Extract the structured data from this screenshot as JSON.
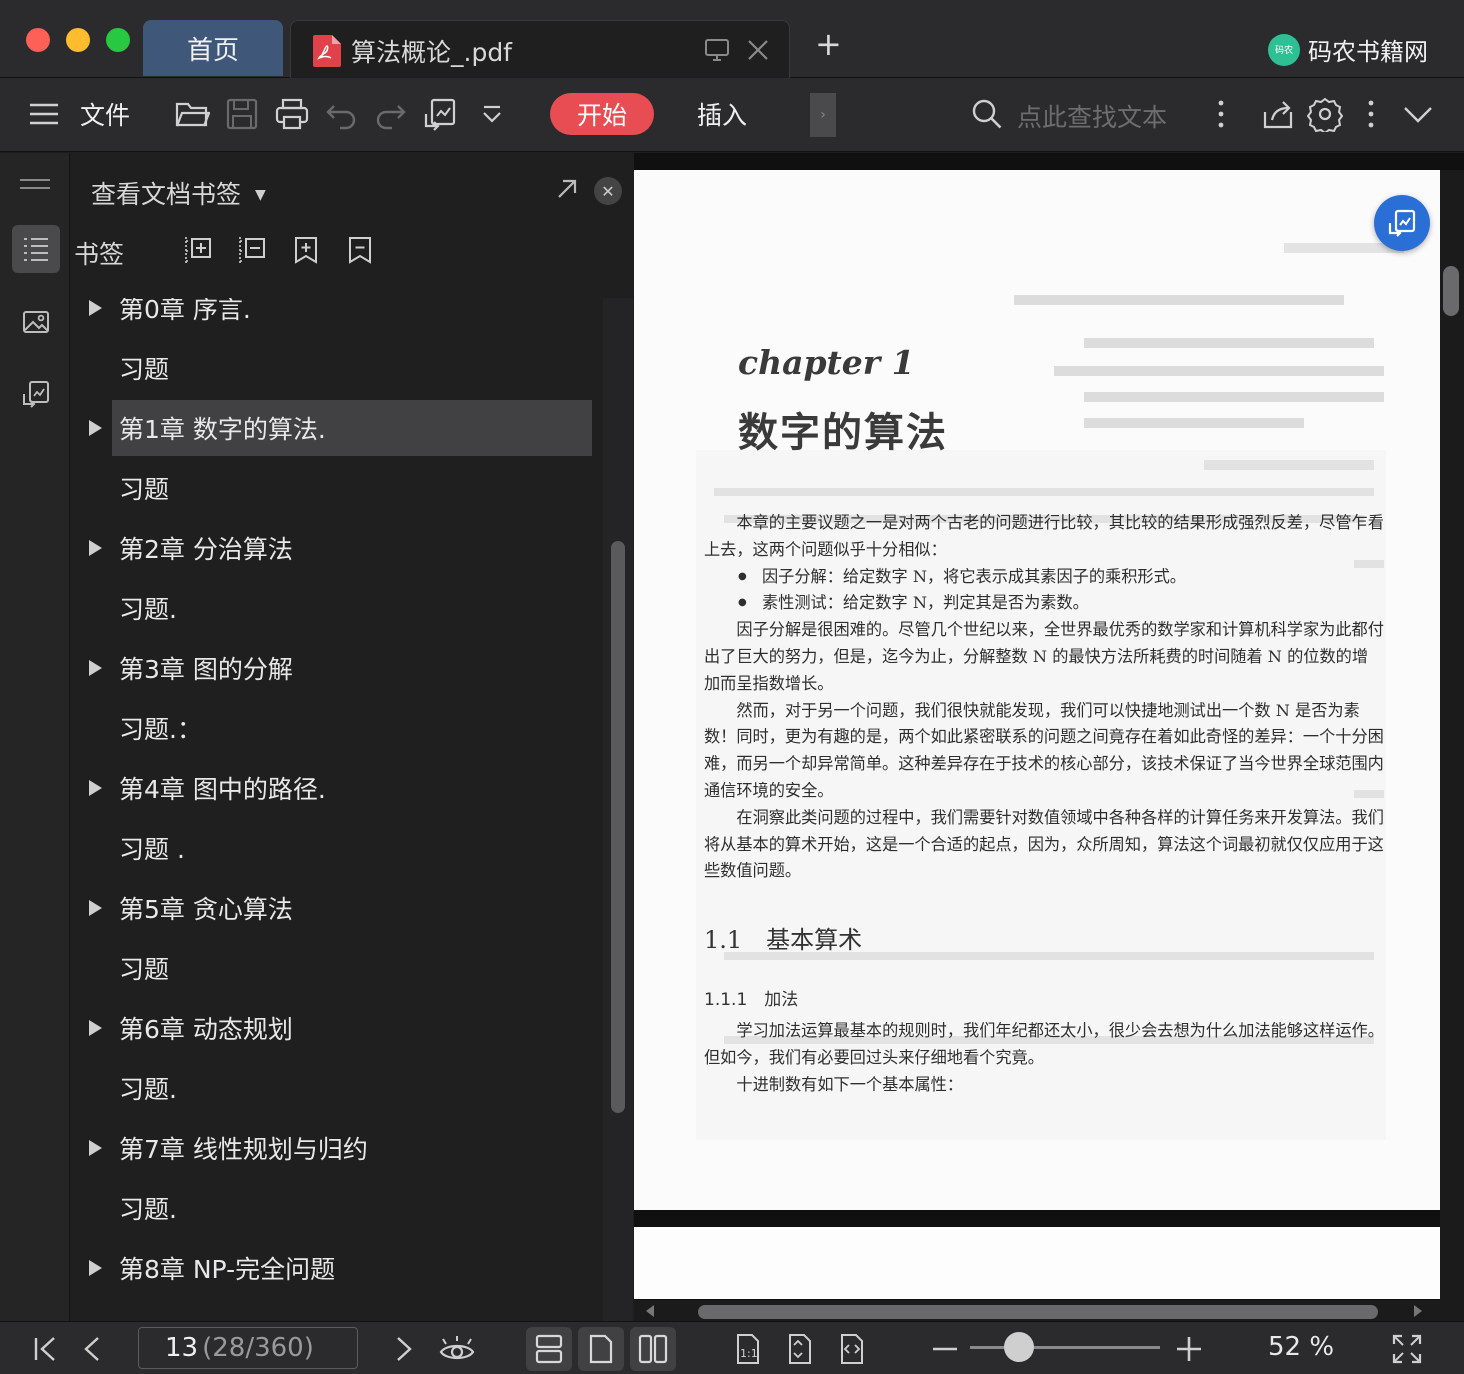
{
  "titlebar": {
    "tabs": [
      {
        "label": "首页"
      },
      {
        "label": "算法概论_.pdf"
      }
    ],
    "new_tab_symbol": "+",
    "brand": {
      "logo_text": "码农",
      "name": "码农书籍网",
      "logo_color": "#2fbf94"
    },
    "traffic_lights": {
      "close": "#fe5f57",
      "minimize": "#febc2e",
      "maximize": "#28c840"
    }
  },
  "toolbar": {
    "file_label": "文件",
    "start_label": "开始",
    "insert_label": "插入",
    "more_symbol": "›",
    "search_placeholder": "点此查找文本",
    "accent_color": "#e94d54"
  },
  "panel": {
    "title": "查看文档书签",
    "bookmarks_label": "书签",
    "close_symbol": "✕",
    "items": [
      {
        "text": "第0章 序言.",
        "has_children": true,
        "selected": false
      },
      {
        "text": "习题",
        "has_children": false,
        "selected": false
      },
      {
        "text": "第1章 数字的算法.",
        "has_children": true,
        "selected": true
      },
      {
        "text": "习题",
        "has_children": false,
        "selected": false
      },
      {
        "text": "第2章 分治算法",
        "has_children": true,
        "selected": false
      },
      {
        "text": "习题.",
        "has_children": false,
        "selected": false
      },
      {
        "text": "第3章 图的分解",
        "has_children": true,
        "selected": false
      },
      {
        "text": "习题.：",
        "has_children": false,
        "selected": false
      },
      {
        "text": "第4章 图中的路径.",
        "has_children": true,
        "selected": false
      },
      {
        "text": "习题 .",
        "has_children": false,
        "selected": false
      },
      {
        "text": "第5章 贪心算法",
        "has_children": true,
        "selected": false
      },
      {
        "text": "习题",
        "has_children": false,
        "selected": false
      },
      {
        "text": "第6章 动态规划",
        "has_children": true,
        "selected": false
      },
      {
        "text": "习题.",
        "has_children": false,
        "selected": false
      },
      {
        "text": "第7章 线性规划与归约",
        "has_children": true,
        "selected": false
      },
      {
        "text": "习题.",
        "has_children": false,
        "selected": false
      },
      {
        "text": "第8章 NP-完全问题",
        "has_children": true,
        "selected": false
      }
    ]
  },
  "document": {
    "chapter_label": "chapter 1",
    "chapter_title": "数字的算法",
    "paragraphs": [
      {
        "kind": "p",
        "text": "本章的主要议题之一是对两个古老的问题进行比较，其比较的结果形成强烈反差，尽管乍看上去，这两个问题似乎十分相似："
      },
      {
        "kind": "bullet",
        "text": "因子分解：给定数字 N，将它表示成其素因子的乘积形式。"
      },
      {
        "kind": "bullet",
        "text": "素性测试：给定数字 N，判定其是否为素数。"
      },
      {
        "kind": "p",
        "text": "因子分解是很困难的。尽管几个世纪以来，全世界最优秀的数学家和计算机科学家为此都付出了巨大的努力，但是，迄今为止，分解整数 N 的最快方法所耗费的时间随着 N 的位数的增加而呈指数增长。"
      },
      {
        "kind": "p",
        "text": "然而，对于另一个问题，我们很快就能发现，我们可以快捷地测试出一个数 N 是否为素数！同时，更为有趣的是，两个如此紧密联系的问题之间竟存在着如此奇怪的差异：一个十分困难，而另一个却异常简单。这种差异存在于技术的核心部分，该技术保证了当今世界全球范围内通信环境的安全。"
      },
      {
        "kind": "p",
        "text": "在洞察此类问题的过程中，我们需要针对数值领域中各种各样的计算任务来开发算法。我们将从基本的算术开始，这是一个合适的起点，因为，众所周知，算法这个词最初就仅仅应用于这些数值问题。"
      }
    ],
    "section_1_1": "1.1　基本算术",
    "section_1_1_1": "1.1.1　加法",
    "paragraphs2": [
      "学习加法运算最基本的规则时，我们年纪都还太小，很少会去想为什么加法能够这样运作。但如今，我们有必要回过头来仔细地看个究竟。",
      "十进制数有如下一个基本属性："
    ]
  },
  "statusbar": {
    "current_page": "13",
    "page_info": "(28/360)",
    "zoom_value": "52 %",
    "zoom_fraction": 0.26
  }
}
